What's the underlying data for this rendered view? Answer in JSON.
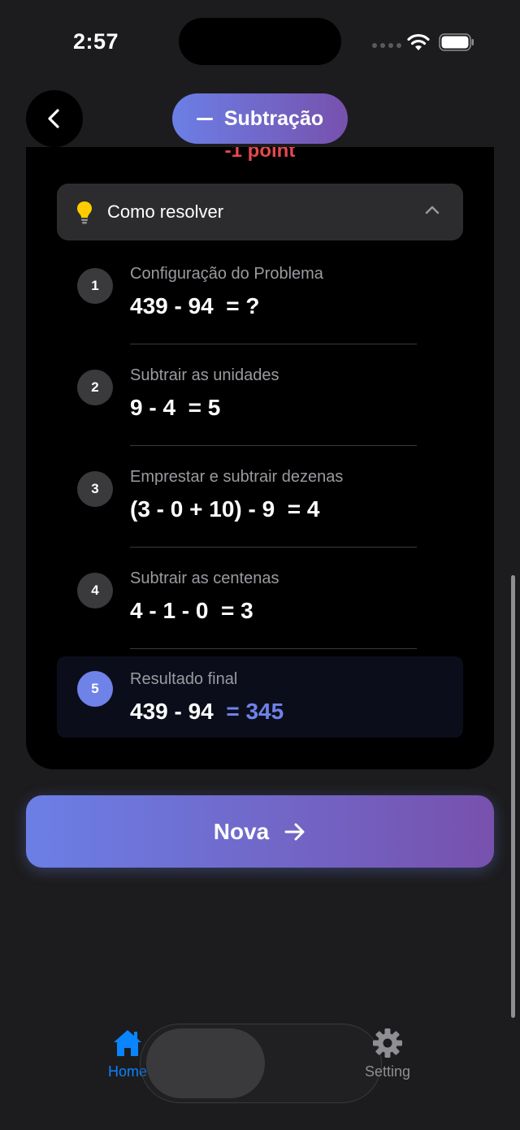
{
  "status_bar": {
    "time": "2:57"
  },
  "header": {
    "operation_label": "Subtração"
  },
  "card": {
    "points_label": "-1 point",
    "howto_title": "Como resolver",
    "steps": [
      {
        "number": "1",
        "title": "Configuração do Problema",
        "expression": "439 - 94  = ?"
      },
      {
        "number": "2",
        "title": "Subtrair as unidades",
        "expression": "9 - 4  = 5"
      },
      {
        "number": "3",
        "title": "Emprestar e subtrair dezenas",
        "expression": "(3 - 0 + 10) - 9  = 4"
      },
      {
        "number": "4",
        "title": "Subtrair as centenas",
        "expression": "4 - 1 - 0  = 3"
      }
    ],
    "final": {
      "number": "5",
      "title": "Resultado final",
      "expression": "439 - 94  ",
      "result": "= 345"
    }
  },
  "nova_button": {
    "label": "Nova"
  },
  "tabbar": {
    "home_label": "Home",
    "setting_label": "Setting"
  },
  "colors": {
    "accent": "#6f82e8",
    "gradient_start": "#6b7fe6",
    "gradient_end": "#7751ad",
    "points_red": "#e5484d",
    "tab_active": "#0a84ff"
  }
}
